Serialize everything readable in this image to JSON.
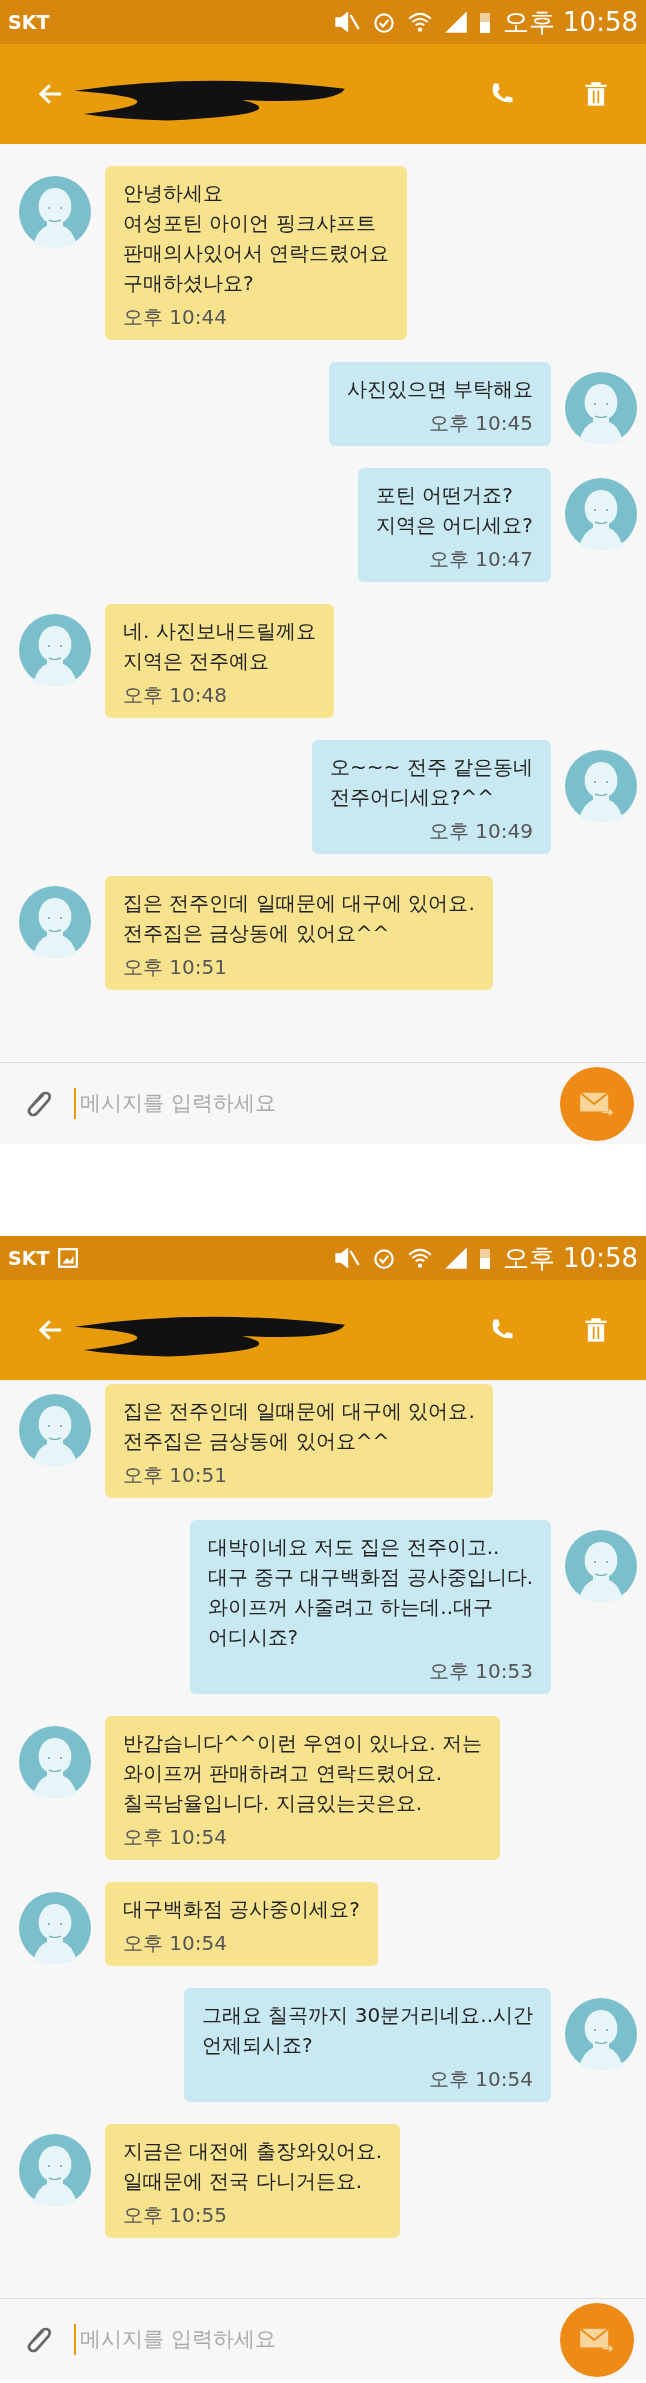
{
  "screens": [
    {
      "status_bar": {
        "carrier": "SKT",
        "image_notification": false,
        "time": "오후 10:58"
      },
      "messages": [
        {
          "kind": "received",
          "text": "안녕하세요\n여성포틴 아이언 핑크샤프트\n판매의사있어서 연락드렸어요\n구매하셨나요?",
          "time": "오후 10:44"
        },
        {
          "kind": "sent",
          "text": "사진있으면 부탁해요",
          "time": "오후 10:45"
        },
        {
          "kind": "sent",
          "text": "포틴 어떤거죠?\n지역은 어디세요?",
          "time": "오후 10:47"
        },
        {
          "kind": "received",
          "text": "네. 사진보내드릴께요\n지역은 전주예요",
          "time": "오후 10:48"
        },
        {
          "kind": "sent",
          "text": "오~~~ 전주 같은동네\n전주어디세요?^^",
          "time": "오후 10:49"
        },
        {
          "kind": "received",
          "text": "집은 전주인데 일때문에 대구에 있어요.\n전주집은 금상동에 있어요^^",
          "time": "오후 10:51"
        }
      ],
      "input": {
        "placeholder": "메시지를 입력하세요"
      }
    },
    {
      "status_bar": {
        "carrier": "SKT",
        "image_notification": true,
        "time": "오후 10:58"
      },
      "messages": [
        {
          "kind": "received",
          "text": "집은 전주인데 일때문에 대구에 있어요.\n전주집은 금상동에 있어요^^",
          "time": "오후 10:51"
        },
        {
          "kind": "sent",
          "text": "대박이네요 저도 집은 전주이고..\n대구 중구 대구백화점  공사중입니다.\n와이프꺼 사줄려고 하는데..대구\n어디시죠?",
          "time": "오후 10:53"
        },
        {
          "kind": "received",
          "text": "반갑습니다^^이런 우연이 있나요. 저는\n와이프꺼 판매하려고 연락드렸어요.\n칠곡남율입니다. 지금있는곳은요.",
          "time": "오후 10:54"
        },
        {
          "kind": "received",
          "text": "대구백화점 공사중이세요?",
          "time": "오후 10:54"
        },
        {
          "kind": "sent",
          "text": "그래요 칠곡까지 30분거리네요..시간\n언제되시죠?",
          "time": "오후 10:54"
        },
        {
          "kind": "received",
          "text": "지금은 대전에 출장와있어요.\n일때문에 전국 다니거든요.",
          "time": "오후 10:55"
        }
      ],
      "input": {
        "placeholder": "메시지를 입력하세요"
      }
    }
  ]
}
